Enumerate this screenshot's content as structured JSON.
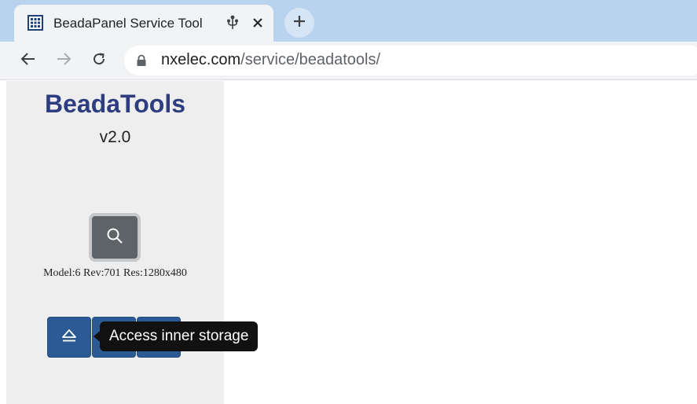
{
  "browser": {
    "tab": {
      "title": "BeadaPanel Service Tool",
      "favicon": "grid-icon",
      "audio_indicator": "usb-icon",
      "close": "close-icon"
    },
    "new_tab": "plus-icon",
    "nav": {
      "back": "back-arrow-icon",
      "forward": "forward-arrow-icon",
      "reload": "reload-icon"
    },
    "address": {
      "security": "lock-icon",
      "host": "nxelec.com",
      "path": "/service/beadatools/"
    }
  },
  "sidebar": {
    "title": "BeadaTools",
    "version": "v2.0",
    "search_button": "search-icon",
    "device_info": "Model:6 Rev:701 Res:1280x480",
    "actions": [
      {
        "icon": "eject-icon"
      },
      {
        "icon": ""
      },
      {
        "icon": ""
      }
    ]
  },
  "tooltip": {
    "text": "Access inner storage"
  },
  "colors": {
    "title": "#2e3d80",
    "action_button": "#2c5a95",
    "tab_strip": "#b9d3ee",
    "sidebar_bg": "#eeeeee"
  }
}
